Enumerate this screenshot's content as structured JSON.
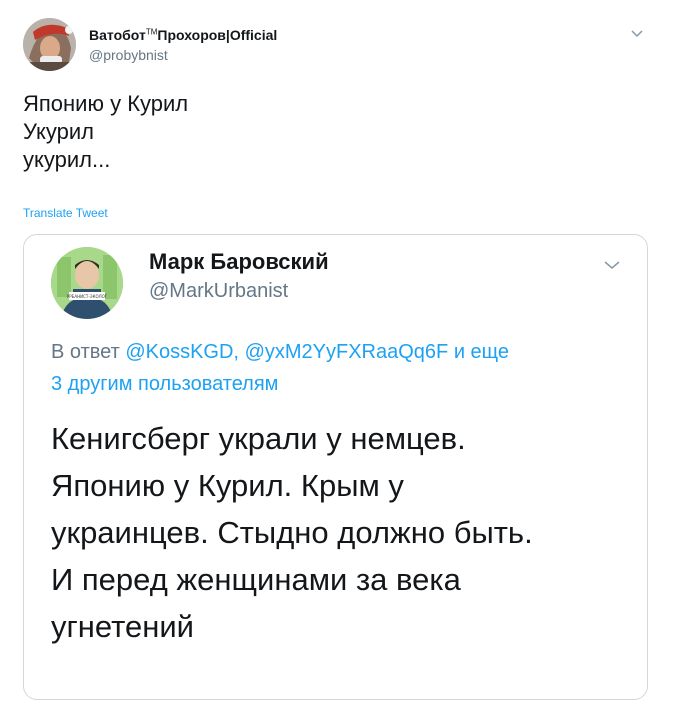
{
  "tweet": {
    "author": {
      "name": "Ватобот",
      "name_tm": "TM",
      "name_rest": "Прохоров|Official",
      "handle": "@probybnist"
    },
    "text_lines": [
      "Японию у Курил",
      "Укурил",
      "укурил..."
    ],
    "translate_label": "Translate Tweet"
  },
  "quote": {
    "author": {
      "name": "Марк Баровский",
      "handle": "@MarkUrbanist",
      "avatar_caption": "УРБАНИСТ-ЭКОЛОГ"
    },
    "reply": {
      "prefix": "В ответ",
      "mention1": "@KossKGD,",
      "mention2": "@yxM2YyFXRaaQq6F",
      "suffix": "и еще",
      "others": "3 другим пользователям"
    },
    "text_lines": [
      "Кенигсберг украли у немцев.",
      "Японию у Курил. Крым у",
      "украинцев. Стыдно должно быть.",
      "И перед женщинами за века",
      "угнетений"
    ]
  },
  "colors": {
    "accent": "#1da1f2",
    "text": "#14171a",
    "muted": "#657786",
    "border": "#cfd9de"
  },
  "icons": {
    "caret": "chevron-down-icon",
    "avatar": "avatar"
  }
}
